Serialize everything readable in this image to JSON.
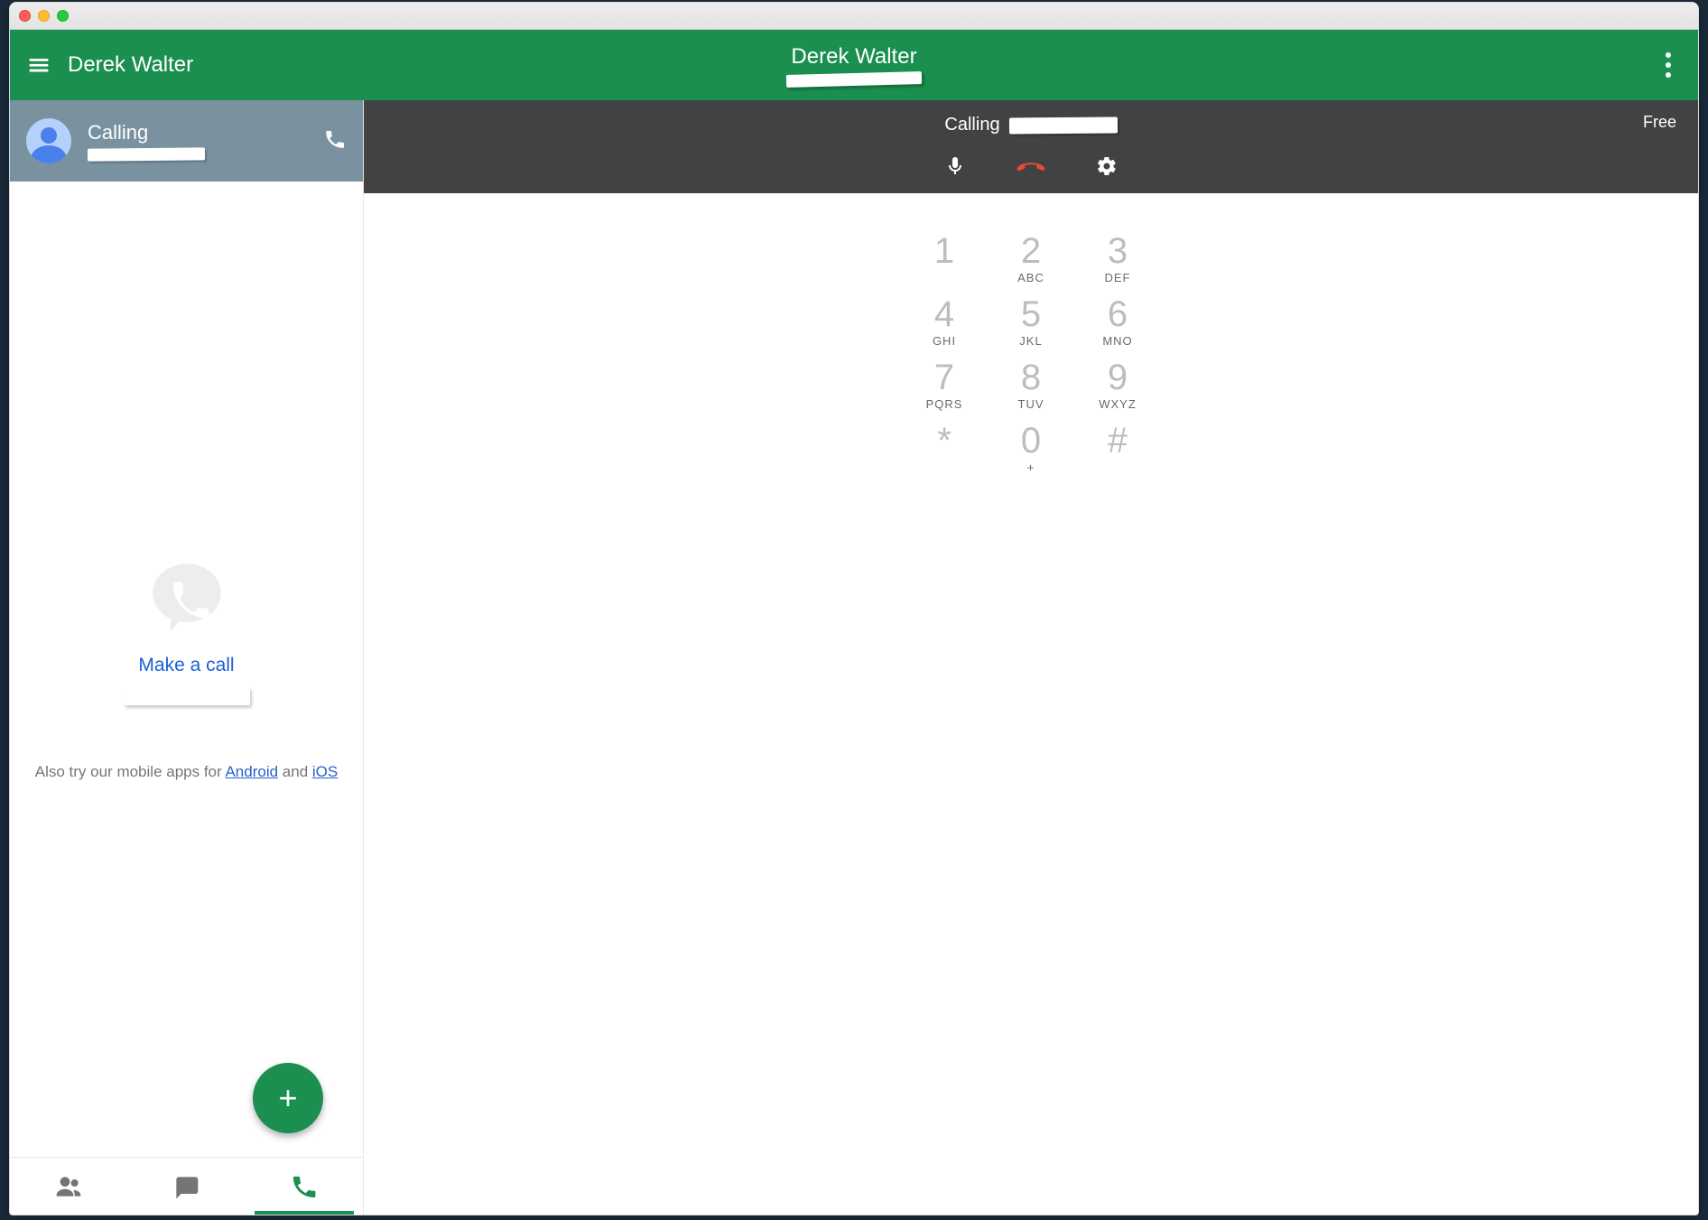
{
  "header": {
    "user_name": "Derek Walter",
    "center_name": "Derek Walter"
  },
  "sidebar": {
    "call_status": "Calling",
    "make_call": "Make a call",
    "promo_prefix": "Also try our mobile apps for ",
    "promo_android": "Android",
    "promo_and": " and ",
    "promo_ios": "iOS"
  },
  "callbar": {
    "free": "Free",
    "calling": "Calling"
  },
  "dialpad": [
    {
      "digit": "1",
      "letters": ""
    },
    {
      "digit": "2",
      "letters": "ABC"
    },
    {
      "digit": "3",
      "letters": "DEF"
    },
    {
      "digit": "4",
      "letters": "GHI"
    },
    {
      "digit": "5",
      "letters": "JKL"
    },
    {
      "digit": "6",
      "letters": "MNO"
    },
    {
      "digit": "7",
      "letters": "PQRS"
    },
    {
      "digit": "8",
      "letters": "TUV"
    },
    {
      "digit": "9",
      "letters": "WXYZ"
    },
    {
      "digit": "*",
      "letters": ""
    },
    {
      "digit": "0",
      "letters": "+"
    },
    {
      "digit": "#",
      "letters": ""
    }
  ]
}
